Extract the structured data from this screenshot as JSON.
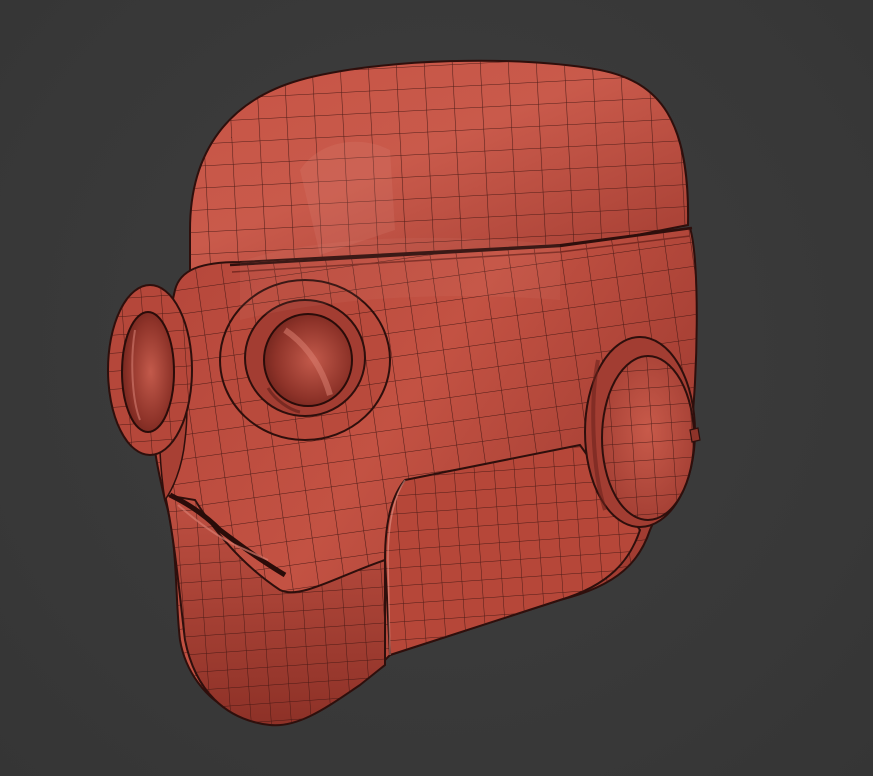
{
  "scene": {
    "subject": "robot-head-model",
    "display": "wireframe-on-shaded",
    "colors": {
      "background": "#3a3a3a",
      "surface": "#b8483c",
      "surface_highlight": "#d26a5c",
      "surface_shadow": "#7a2a22",
      "wire": "#3d1410"
    }
  }
}
